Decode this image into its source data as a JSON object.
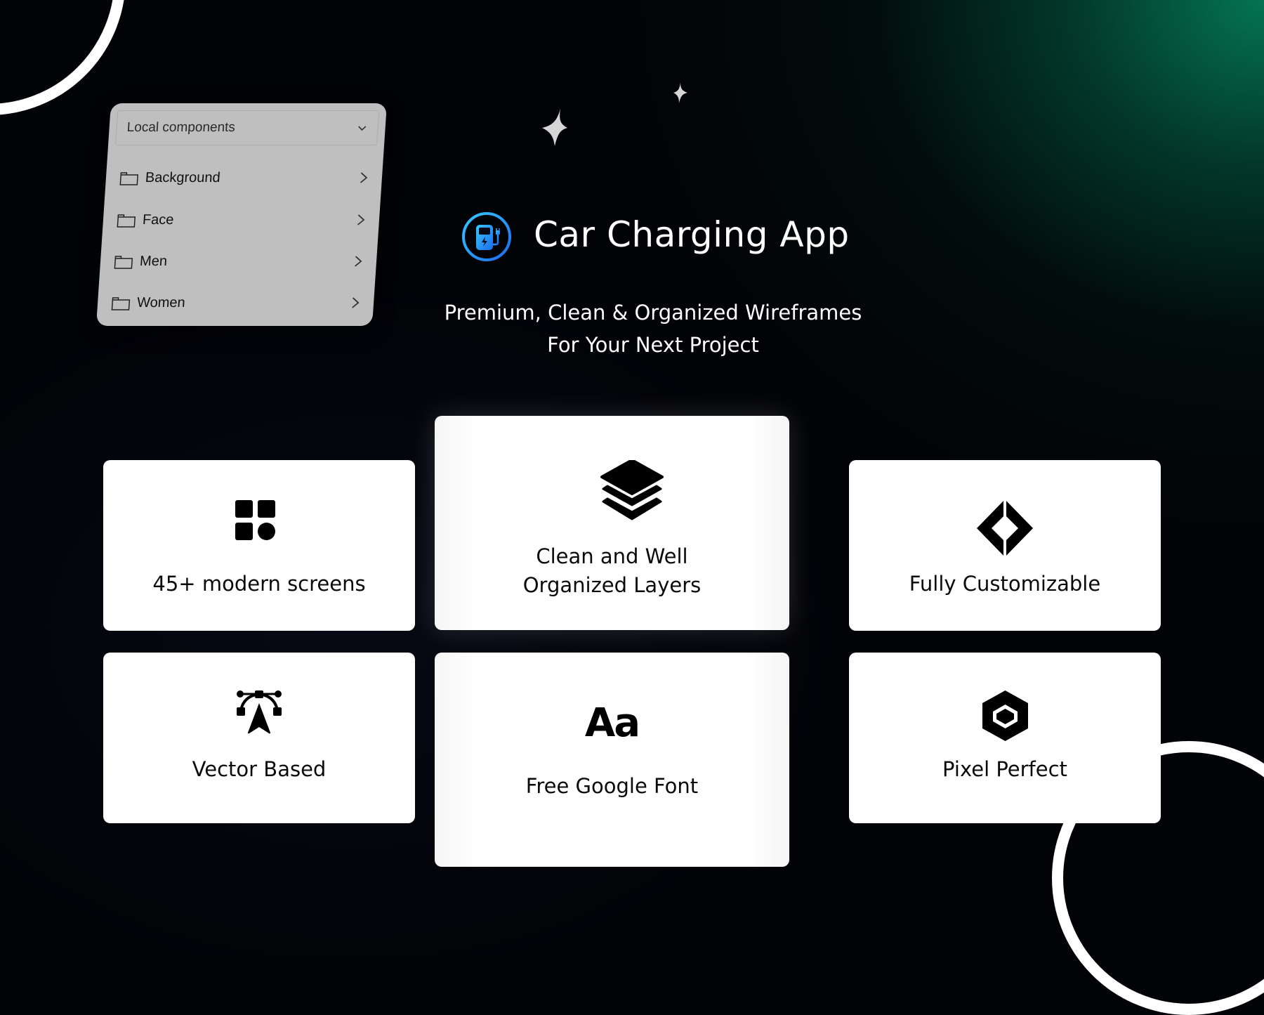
{
  "header": {
    "title": "Car Charging App",
    "subtitle_line1": "Premium, Clean & Organized Wireframes",
    "subtitle_line2": "For Your Next Project",
    "logo_icon": "ev-charger-icon",
    "logo_color": "#1e90ff"
  },
  "components_panel": {
    "dropdown_label": "Local components",
    "items": [
      {
        "label": "Background",
        "icon": "folder-icon"
      },
      {
        "label": "Face",
        "icon": "folder-icon"
      },
      {
        "label": "Men",
        "icon": "folder-icon"
      },
      {
        "label": "Women",
        "icon": "folder-icon"
      }
    ]
  },
  "features": [
    {
      "label": "45+ modern screens",
      "icon": "apps-grid-icon"
    },
    {
      "label_line1": "Clean and Well",
      "label_line2": "Organized Layers",
      "icon": "layers-icon"
    },
    {
      "label": "Fully Customizable",
      "icon": "diamond-icon"
    },
    {
      "label": "Vector Based",
      "icon": "vector-pen-icon"
    },
    {
      "label": "Free Google Font",
      "icon_text": "Aa"
    },
    {
      "label": "Pixel Perfect",
      "icon": "hexagon-icon"
    }
  ],
  "theme": {
    "background": "#020307",
    "glow": "#047a56",
    "card": "#ffffff",
    "panel": "#bfbfbf"
  }
}
